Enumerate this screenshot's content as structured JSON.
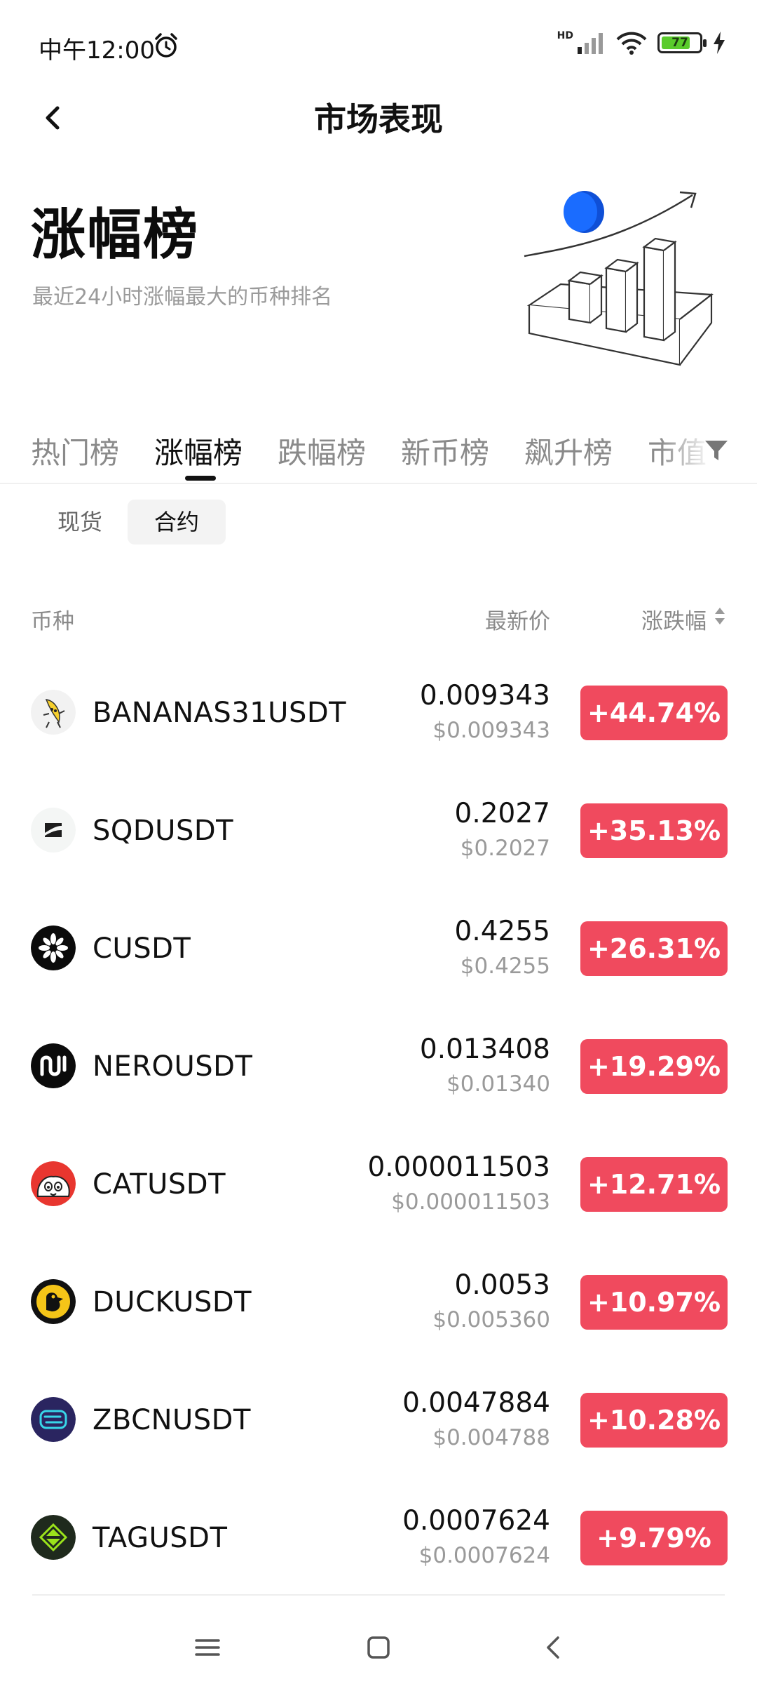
{
  "status_bar": {
    "time": "中午12:00",
    "network_label": "HD",
    "battery_level": "77",
    "battery_fraction": 0.77
  },
  "header": {
    "title": "市场表现"
  },
  "hero": {
    "title": "涨幅榜",
    "subtitle": "最近24小时涨幅最大的币种排名"
  },
  "tabs": [
    {
      "label": "热门榜",
      "active": false
    },
    {
      "label": "涨幅榜",
      "active": true
    },
    {
      "label": "跌幅榜",
      "active": false
    },
    {
      "label": "新币榜",
      "active": false
    },
    {
      "label": "飙升榜",
      "active": false
    },
    {
      "label": "市值",
      "active": false
    }
  ],
  "segments": [
    {
      "label": "现货",
      "active": false
    },
    {
      "label": "合约",
      "active": true
    }
  ],
  "columns": {
    "coin": "币种",
    "price": "最新价",
    "change": "涨跌幅"
  },
  "colors": {
    "gain": "#f04a5e",
    "hero_accent": "#1a6cff"
  },
  "rows": [
    {
      "symbol": "BANANAS31USDT",
      "price": "0.009343",
      "price_usd": "$0.009343",
      "change": "+44.74%",
      "icon": "banana-icon"
    },
    {
      "symbol": "SQDUSDT",
      "price": "0.2027",
      "price_usd": "$0.2027",
      "change": "+35.13%",
      "icon": "sqd-icon"
    },
    {
      "symbol": "CUSDT",
      "price": "0.4255",
      "price_usd": "$0.4255",
      "change": "+26.31%",
      "icon": "c-icon"
    },
    {
      "symbol": "NEROUSDT",
      "price": "0.013408",
      "price_usd": "$0.01340",
      "change": "+19.29%",
      "icon": "nero-icon"
    },
    {
      "symbol": "CATUSDT",
      "price": "0.000011503",
      "price_usd": "$0.000011503",
      "change": "+12.71%",
      "icon": "cat-icon"
    },
    {
      "symbol": "DUCKUSDT",
      "price": "0.0053",
      "price_usd": "$0.005360",
      "change": "+10.97%",
      "icon": "duck-icon"
    },
    {
      "symbol": "ZBCNUSDT",
      "price": "0.0047884",
      "price_usd": "$0.004788",
      "change": "+10.28%",
      "icon": "zbcn-icon"
    },
    {
      "symbol": "TAGUSDT",
      "price": "0.0007624",
      "price_usd": "$0.0007624",
      "change": "+9.79%",
      "icon": "tag-icon"
    }
  ]
}
